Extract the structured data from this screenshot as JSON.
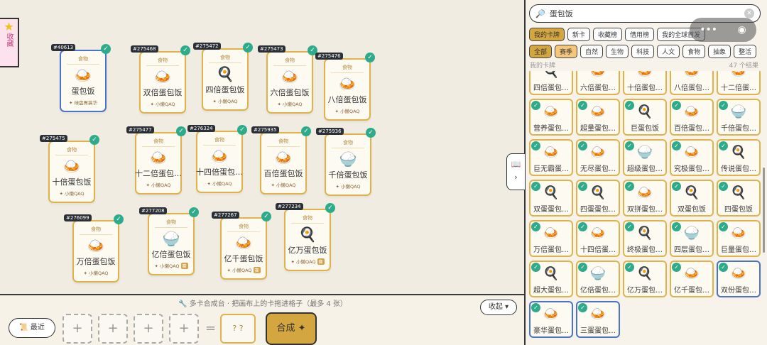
{
  "favorites_label": "收藏",
  "canvas_cards": [
    {
      "id": "#40613",
      "cat": "食物",
      "icon": "🍛",
      "name": "蛋包饭",
      "author": "✦ 绿盘胃搞华",
      "tag": "",
      "sel": true
    },
    {
      "id": "#275468",
      "cat": "食物",
      "icon": "🍛",
      "name": "双倍蛋包饭",
      "author": "✦ 小懒QAQ",
      "tag": ""
    },
    {
      "id": "#275472",
      "cat": "食物",
      "icon": "🍳",
      "name": "四倍蛋包饭",
      "author": "✦ 小懒QAQ",
      "tag": ""
    },
    {
      "id": "#275473",
      "cat": "食物",
      "icon": "🍛",
      "name": "六倍蛋包饭",
      "author": "✦ 小懒QAQ",
      "tag": ""
    },
    {
      "id": "#275476",
      "cat": "食物",
      "icon": "🍛",
      "name": "八倍蛋包饭",
      "author": "✦ 小懒QAQ",
      "tag": ""
    },
    {
      "id": "#275475",
      "cat": "食物",
      "icon": "🍛",
      "name": "十倍蛋包饭",
      "author": "✦ 小懒QAQ",
      "tag": ""
    },
    {
      "id": "#275477",
      "cat": "食物",
      "icon": "🍛",
      "name": "十二倍蛋包…",
      "author": "✦ 小懒QAQ",
      "tag": ""
    },
    {
      "id": "#276324",
      "cat": "食物",
      "icon": "🍛",
      "name": "十四倍蛋包…",
      "author": "✦ 小懒QAQ",
      "tag": ""
    },
    {
      "id": "#275935",
      "cat": "食物",
      "icon": "🍛",
      "name": "百倍蛋包饭",
      "author": "✦ 小懒QAQ",
      "tag": ""
    },
    {
      "id": "#275936",
      "cat": "食物",
      "icon": "🍚",
      "name": "千倍蛋包饭",
      "author": "✦ 小懒QAQ",
      "tag": ""
    },
    {
      "id": "#276099",
      "cat": "食物",
      "icon": "🍛",
      "name": "万倍蛋包饭",
      "author": "✦ 小懒QAQ",
      "tag": ""
    },
    {
      "id": "#277208",
      "cat": "食物",
      "icon": "🍚",
      "name": "亿倍蛋包饭",
      "author": "✦ 小懒QAQ",
      "tag": "赛"
    },
    {
      "id": "#277267",
      "cat": "食物",
      "icon": "🍛",
      "name": "亿千蛋包饭",
      "author": "✦ 小懒QAQ",
      "tag": "赛"
    },
    {
      "id": "#277234",
      "cat": "食物",
      "icon": "🍳",
      "name": "亿万蛋包饭",
      "author": "✦ 小懒QAQ",
      "tag": "赛"
    }
  ],
  "workbench": {
    "hint": "🔧 多卡合成台 · 把画布上的卡拖进格子（最多 4 张）",
    "collapse": "收起 ▾",
    "recent": "📜 最近",
    "slot": "+",
    "eq": "=",
    "result": "? ?",
    "craft": "合成 ✦"
  },
  "panel": {
    "search_value": "蛋包饭",
    "tabs": [
      "我的卡牌",
      "新卡",
      "收藏榜",
      "借用榜",
      "我的全球首发"
    ],
    "filters": [
      "全部",
      "赛季",
      "自然",
      "生物",
      "科技",
      "人文",
      "食物",
      "抽象",
      "整活"
    ],
    "my_cards": "我的卡牌",
    "results": "47 个结果",
    "grid": [
      {
        "icon": "🍳",
        "name": "四倍蛋包…",
        "chk": false
      },
      {
        "icon": "🍛",
        "name": "六倍蛋包…",
        "chk": false
      },
      {
        "icon": "🍛",
        "name": "十倍蛋包…",
        "chk": false
      },
      {
        "icon": "🍛",
        "name": "八倍蛋包…",
        "chk": false
      },
      {
        "icon": "🍛",
        "name": "十二倍蛋…",
        "chk": false
      },
      {
        "icon": "🍛",
        "name": "营养蛋包…",
        "chk": true
      },
      {
        "icon": "🍛",
        "name": "超量蛋包…",
        "chk": true
      },
      {
        "icon": "🍳",
        "name": "巨蛋包饭",
        "chk": true
      },
      {
        "icon": "🍛",
        "name": "百倍蛋包…",
        "chk": true
      },
      {
        "icon": "🍚",
        "name": "千倍蛋包…",
        "chk": true
      },
      {
        "icon": "🍛",
        "name": "巨无霸蛋…",
        "chk": true
      },
      {
        "icon": "🍛",
        "name": "无尽蛋包…",
        "chk": true
      },
      {
        "icon": "🍚",
        "name": "超级蛋包…",
        "chk": true
      },
      {
        "icon": "🍛",
        "name": "究极蛋包…",
        "chk": true
      },
      {
        "icon": "🍳",
        "name": "传说蛋包…",
        "chk": true
      },
      {
        "icon": "🍳",
        "name": "双蛋蛋包…",
        "chk": true
      },
      {
        "icon": "🍳",
        "name": "四蛋蛋包…",
        "chk": true
      },
      {
        "icon": "🍛",
        "name": "双拼蛋包…",
        "chk": true
      },
      {
        "icon": "🍳",
        "name": "双蛋包饭",
        "chk": true
      },
      {
        "icon": "🍳",
        "name": "四蛋包饭",
        "chk": true
      },
      {
        "icon": "🍛",
        "name": "万倍蛋包…",
        "chk": true
      },
      {
        "icon": "🍛",
        "name": "十四倍蛋…",
        "chk": true
      },
      {
        "icon": "🍳",
        "name": "终极蛋包…",
        "chk": true
      },
      {
        "icon": "🍚",
        "name": "四层蛋包…",
        "chk": true
      },
      {
        "icon": "🍛",
        "name": "巨量蛋包…",
        "chk": true
      },
      {
        "icon": "🍳",
        "name": "超大蛋包…",
        "chk": true
      },
      {
        "icon": "🍚",
        "name": "亿倍蛋包…",
        "chk": true
      },
      {
        "icon": "🍳",
        "name": "亿万蛋包…",
        "chk": true
      },
      {
        "icon": "🍛",
        "name": "亿千蛋包…",
        "chk": true
      },
      {
        "icon": "🍛",
        "name": "双份蛋包…",
        "chk": true,
        "sel": true
      },
      {
        "icon": "🍛",
        "name": "豪华蛋包…",
        "chk": true,
        "sel": true
      },
      {
        "icon": "🍛",
        "name": "三蛋蛋包…",
        "chk": true,
        "sel": true
      }
    ]
  }
}
